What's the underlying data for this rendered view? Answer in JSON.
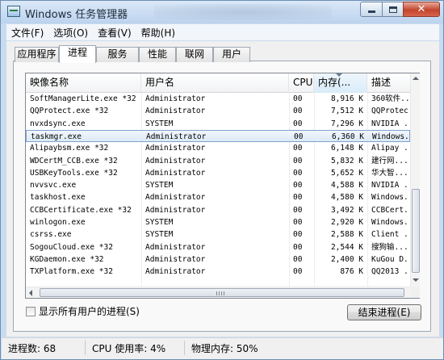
{
  "window": {
    "title": "Windows 任务管理器"
  },
  "menu": [
    {
      "label": "文件(F)"
    },
    {
      "label": "选项(O)"
    },
    {
      "label": "查看(V)"
    },
    {
      "label": "帮助(H)"
    }
  ],
  "tabs": [
    {
      "label": "应用程序"
    },
    {
      "label": "进程",
      "active": true
    },
    {
      "label": "服务"
    },
    {
      "label": "性能"
    },
    {
      "label": "联网"
    },
    {
      "label": "用户"
    }
  ],
  "columns": {
    "name": "映像名称",
    "user": "用户名",
    "cpu": "CPU",
    "mem": "内存(...",
    "desc": "描述"
  },
  "sorted_column": "mem",
  "processes": [
    {
      "name": "SoftManagerLite.exe *32",
      "user": "Administrator",
      "cpu": "00",
      "mem": "8,916 K",
      "desc": "360软件..."
    },
    {
      "name": "QQProtect.exe *32",
      "user": "Administrator",
      "cpu": "00",
      "mem": "7,512 K",
      "desc": "QQProtec"
    },
    {
      "name": "nvxdsync.exe",
      "user": "SYSTEM",
      "cpu": "00",
      "mem": "7,296 K",
      "desc": "NVIDIA ..."
    },
    {
      "name": "taskmgr.exe",
      "user": "Administrator",
      "cpu": "00",
      "mem": "6,360 K",
      "desc": "Windows..",
      "selected": true
    },
    {
      "name": "Alipaybsm.exe *32",
      "user": "Administrator",
      "cpu": "00",
      "mem": "6,148 K",
      "desc": "Alipay ..."
    },
    {
      "name": "WDCertM_CCB.exe *32",
      "user": "Administrator",
      "cpu": "00",
      "mem": "5,832 K",
      "desc": "建行网..."
    },
    {
      "name": "USBKeyTools.exe *32",
      "user": "Administrator",
      "cpu": "00",
      "mem": "5,652 K",
      "desc": "华大智..."
    },
    {
      "name": "nvvsvc.exe",
      "user": "SYSTEM",
      "cpu": "00",
      "mem": "4,588 K",
      "desc": "NVIDIA ..."
    },
    {
      "name": "taskhost.exe",
      "user": "Administrator",
      "cpu": "00",
      "mem": "4,580 K",
      "desc": "Windows..."
    },
    {
      "name": "CCBCertificate.exe *32",
      "user": "Administrator",
      "cpu": "00",
      "mem": "3,492 K",
      "desc": "CCBCert..."
    },
    {
      "name": "winlogon.exe",
      "user": "SYSTEM",
      "cpu": "00",
      "mem": "2,920 K",
      "desc": "Windows..."
    },
    {
      "name": "csrss.exe",
      "user": "SYSTEM",
      "cpu": "00",
      "mem": "2,588 K",
      "desc": "Client ..."
    },
    {
      "name": "SogouCloud.exe *32",
      "user": "Administrator",
      "cpu": "00",
      "mem": "2,544 K",
      "desc": "搜狗输..."
    },
    {
      "name": "KGDaemon.exe *32",
      "user": "Administrator",
      "cpu": "00",
      "mem": "2,400 K",
      "desc": "KuGou D..."
    },
    {
      "name": "TXPlatform.exe *32",
      "user": "Administrator",
      "cpu": "00",
      "mem": "876 K",
      "desc": "QQ2013 ..."
    }
  ],
  "show_all_users": {
    "label": "显示所有用户的进程(S)",
    "checked": false
  },
  "end_process_button": "结束进程(E)",
  "status": {
    "processes": "进程数: 68",
    "cpu": "CPU 使用率: 4%",
    "memory": "物理内存: 50%"
  },
  "icons": {
    "app": "taskmgr-icon",
    "minimize": "minimize-icon",
    "maximize": "maximize-icon",
    "close": "close-icon"
  }
}
